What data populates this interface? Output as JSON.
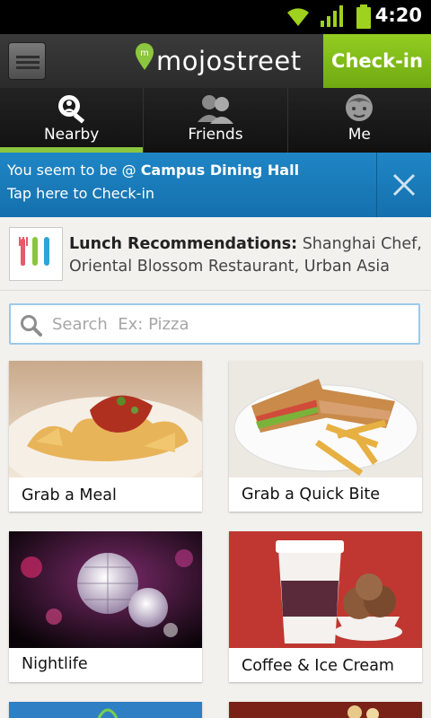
{
  "status_bar": {
    "time": "4:20"
  },
  "header": {
    "brand": "mojostreet",
    "checkin_label": "Check-in"
  },
  "tabs": [
    {
      "label": "Nearby",
      "icon": "nearby-search-icon",
      "active": true
    },
    {
      "label": "Friends",
      "icon": "friends-icon",
      "active": false
    },
    {
      "label": "Me",
      "icon": "me-face-icon",
      "active": false
    }
  ],
  "banner": {
    "prefix": "You seem to be @ ",
    "place": "Campus Dining Hall",
    "action": "Tap here to Check-in"
  },
  "recommendation": {
    "title": "Lunch Recommendations:",
    "places": " Shanghai Chef, Oriental Blossom Restaurant, Urban Asia"
  },
  "search": {
    "placeholder": "Search  Ex: Pizza",
    "value": ""
  },
  "tiles": [
    {
      "label": "Grab a Meal",
      "image": "pasta-photo"
    },
    {
      "label": "Grab a Quick Bite",
      "image": "sandwich-photo"
    },
    {
      "label": "Nightlife",
      "image": "disco-ball-photo"
    },
    {
      "label": "Coffee & Ice Cream",
      "image": "coffee-icecream-photo"
    }
  ],
  "colors": {
    "accent_green": "#8cc63f",
    "banner_blue": "#1a7dbf",
    "header_dark": "#2b2b2b"
  }
}
